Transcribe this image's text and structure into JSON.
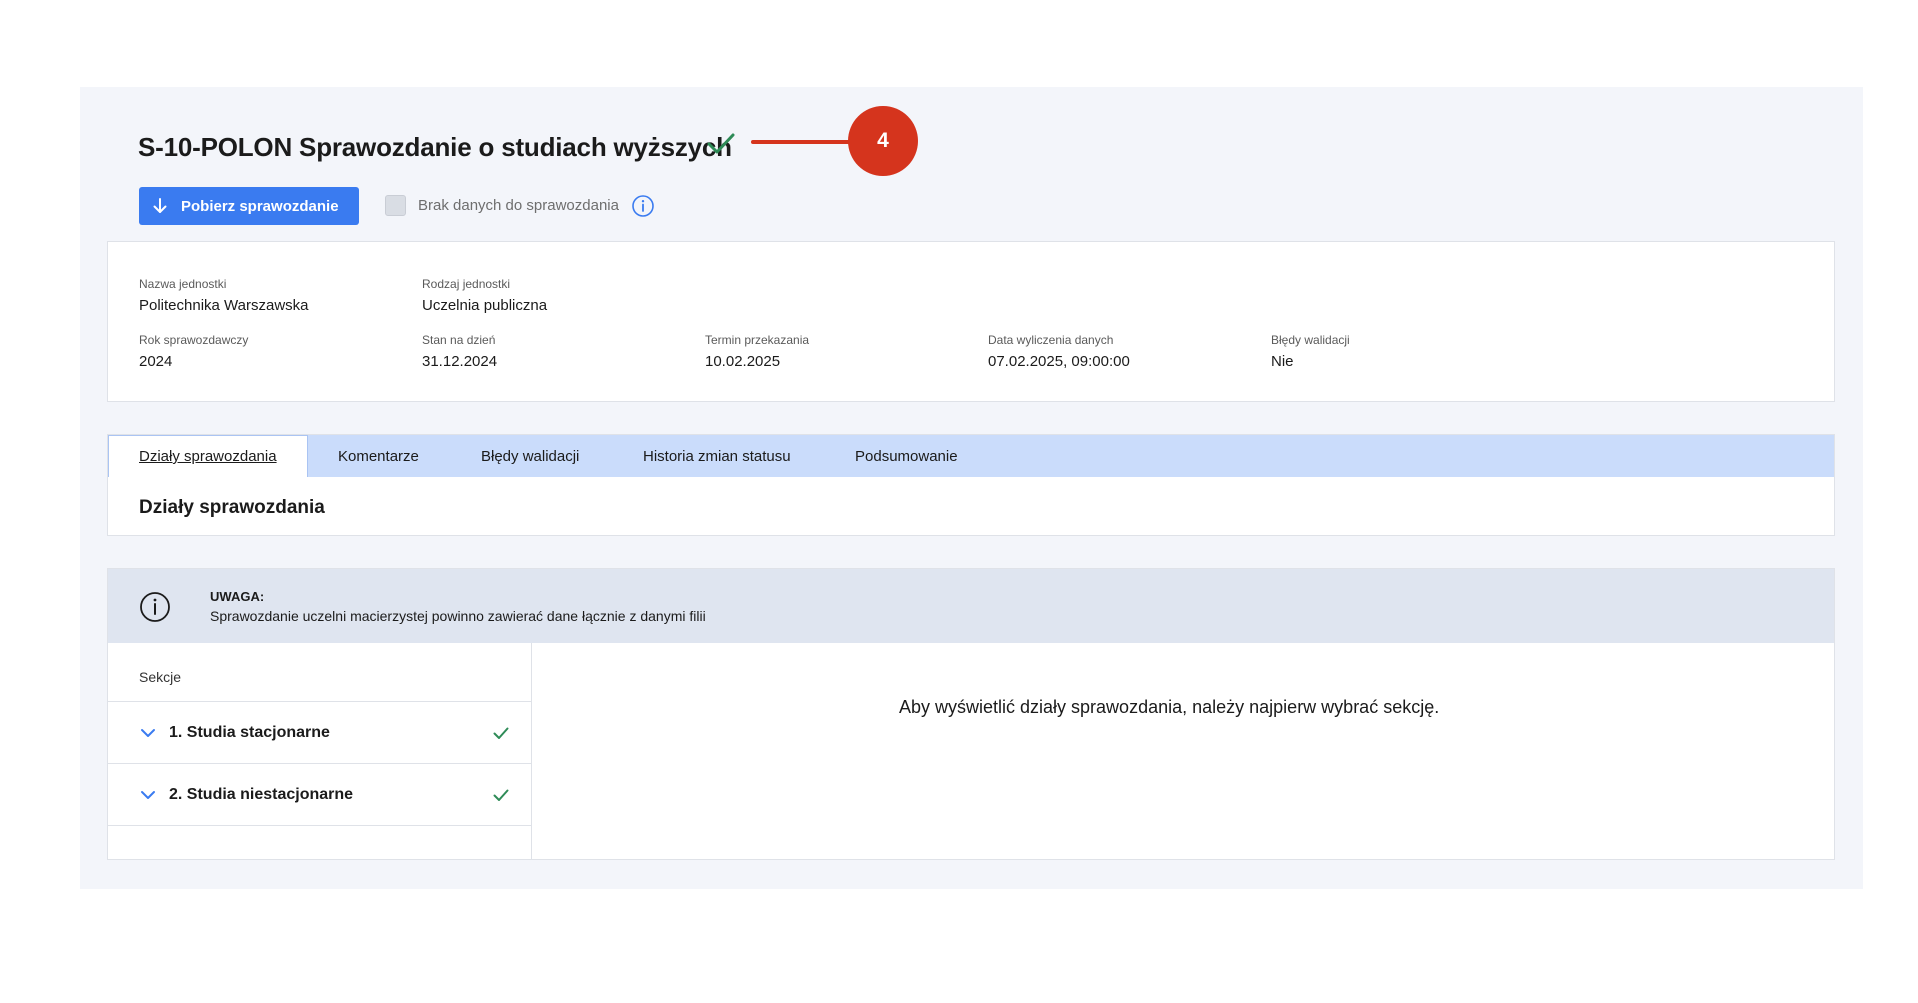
{
  "header": {
    "title": "S-10-POLON Sprawozdanie o studiach wyższych",
    "callout_number": "4"
  },
  "toolbar": {
    "download_label": "Pobierz sprawozdanie",
    "no_data_label": "Brak danych do sprawozdania",
    "no_data_checked": false
  },
  "info": {
    "unit_name_label": "Nazwa jednostki",
    "unit_name_value": "Politechnika Warszawska",
    "unit_type_label": "Rodzaj jednostki",
    "unit_type_value": "Uczelnia publiczna",
    "year_label": "Rok sprawozdawczy",
    "year_value": "2024",
    "state_label": "Stan na dzień",
    "state_value": "31.12.2024",
    "deadline_label": "Termin przekazania",
    "deadline_value": "10.02.2025",
    "calc_label": "Data wyliczenia danych",
    "calc_value": "07.02.2025, 09:00:00",
    "errors_label": "Błędy walidacji",
    "errors_value": "Nie"
  },
  "tabs": [
    {
      "label": "Działy sprawozdania",
      "active": true
    },
    {
      "label": "Komentarze",
      "active": false
    },
    {
      "label": "Błędy walidacji",
      "active": false
    },
    {
      "label": "Historia zmian statusu",
      "active": false
    },
    {
      "label": "Podsumowanie",
      "active": false
    }
  ],
  "section_heading": "Działy sprawozdania",
  "notice": {
    "title": "UWAGA:",
    "text": "Sprawozdanie uczelni macierzystej powinno zawierać dane łącznie z danymi filii"
  },
  "sections": {
    "header": "Sekcje",
    "items": [
      {
        "label": "1. Studia stacjonarne",
        "status": "ok"
      },
      {
        "label": "2. Studia niestacjonarne",
        "status": "ok"
      }
    ]
  },
  "placeholder": "Aby wyświetlić działy sprawozdania, należy najpierw wybrać sekcję.",
  "colors": {
    "primary": "#3a7bf0",
    "success": "#2e8b57",
    "callout": "#d5341d",
    "tabbar": "#cadcfb",
    "notice": "#dfe5f0"
  }
}
